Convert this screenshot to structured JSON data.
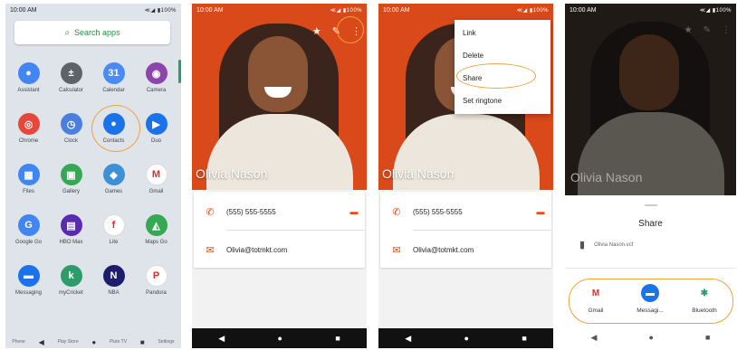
{
  "panel_app_drawer": {
    "time": "10:00 AM",
    "status_icons": "≪◢ ▮100%",
    "search_placeholder": "Search apps",
    "apps": [
      {
        "label": "Assistant",
        "icon": "assistant-icon",
        "color": "#4285f4",
        "glyph": "●"
      },
      {
        "label": "Calculator",
        "icon": "calculator-icon",
        "color": "#5f6368",
        "glyph": "±"
      },
      {
        "label": "Calendar",
        "icon": "calendar-icon",
        "color": "#4a8af4",
        "glyph": "31"
      },
      {
        "label": "Camera",
        "icon": "camera-icon",
        "color": "#8e44ad",
        "glyph": "◉"
      },
      {
        "label": "Chrome",
        "icon": "chrome-icon",
        "color": "#e8453c",
        "glyph": "◎"
      },
      {
        "label": "Clock",
        "icon": "clock-icon",
        "color": "#4a7fe0",
        "glyph": "◷"
      },
      {
        "label": "Contacts",
        "icon": "contacts-icon",
        "color": "#1a73e8",
        "glyph": "●"
      },
      {
        "label": "Duo",
        "icon": "duo-icon",
        "color": "#1a73e8",
        "glyph": "▶"
      },
      {
        "label": "Files",
        "icon": "files-icon",
        "color": "#4285f4",
        "glyph": "▦"
      },
      {
        "label": "Gallery",
        "icon": "gallery-icon",
        "color": "#34a853",
        "glyph": "▣"
      },
      {
        "label": "Games",
        "icon": "games-icon",
        "color": "#3d8fd6",
        "glyph": "◆"
      },
      {
        "label": "Gmail",
        "icon": "gmail-icon",
        "color": "#ffffff",
        "glyph": "M"
      },
      {
        "label": "Google Go",
        "icon": "google-go-icon",
        "color": "#4285f4",
        "glyph": "G"
      },
      {
        "label": "HBO Max",
        "icon": "hbo-max-icon",
        "color": "#5b2ab3",
        "glyph": "▤"
      },
      {
        "label": "Lite",
        "icon": "facebook-lite-icon",
        "color": "#ffffff",
        "glyph": "f"
      },
      {
        "label": "Maps Go",
        "icon": "maps-go-icon",
        "color": "#34a853",
        "glyph": "◭"
      },
      {
        "label": "Messaging",
        "icon": "messaging-icon",
        "color": "#1a73e8",
        "glyph": "▬"
      },
      {
        "label": "myCricket",
        "icon": "mycricket-icon",
        "color": "#2e9c6a",
        "glyph": "k"
      },
      {
        "label": "NBA",
        "icon": "nba-icon",
        "color": "#1d1d6b",
        "glyph": "N"
      },
      {
        "label": "Pandora",
        "icon": "pandora-icon",
        "color": "#ffffff",
        "glyph": "P"
      }
    ],
    "dock": {
      "phone": "Phone",
      "playstore": "Play Store",
      "plutotv": "Pluto TV",
      "settings": "Settings"
    }
  },
  "panel_contact": {
    "time": "10:00 AM",
    "status_icons": "≪◢ ▮100%",
    "contact_name": "Olivia Nason",
    "phone": "(555) 555-5555",
    "email": "Olivia@totmkt.com"
  },
  "panel_menu": {
    "time": "10:00 AM",
    "status_icons": "≪◢ ▮100%",
    "contact_name": "Olivia Nason",
    "phone": "(555) 555-5555",
    "email": "Olivia@totmkt.com",
    "menu_items": [
      "Link",
      "Delete",
      "Share",
      "Set ringtone"
    ]
  },
  "panel_share": {
    "time": "10:00 AM",
    "status_icons": "≪◢ ▮100%",
    "contact_name": "Olivia Nason",
    "sheet_title": "Share",
    "file_name": "Olivia Nason.vcf",
    "targets": [
      {
        "label": "Gmail",
        "icon": "gmail-icon",
        "color": "#d93025",
        "bg": "#ffffff",
        "glyph": "M"
      },
      {
        "label": "Messagi...",
        "icon": "messaging-icon",
        "color": "#ffffff",
        "bg": "#1a73e8",
        "glyph": "▬"
      },
      {
        "label": "Bluetooth",
        "icon": "bluetooth-icon",
        "color": "#2e9c6a",
        "bg": "#ffffff",
        "glyph": "✱"
      }
    ]
  },
  "colors": {
    "accent_orange": "#e64a19",
    "highlight": "#f0a33b"
  }
}
